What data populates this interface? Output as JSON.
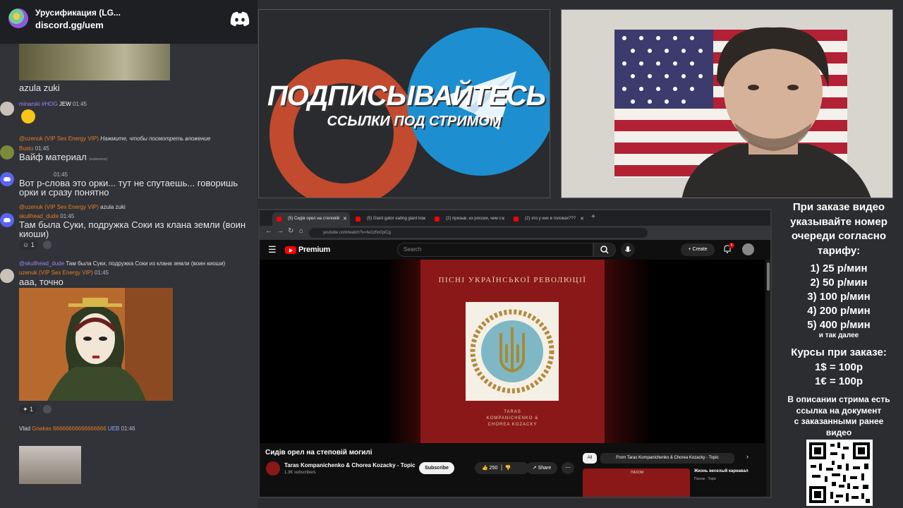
{
  "discord": {
    "server_name": "Урусификация (LG...",
    "invite_link": "discord.gg/uem",
    "messages": {
      "m1_text": "azula zuki",
      "m2_user": "minarski",
      "m2_tag": "#HOG",
      "m2_badge": "JEW",
      "m2_time": "01:45",
      "m3_reply_user": "@uzenuk (VIP Sex Energy VIP)",
      "m3_reply_text": "Нажмите, чтобы посмотреть вложение",
      "m3_user": "Bustu",
      "m3_time": "01:45",
      "m3_text": "Вайф материал",
      "m3_edited": "(изменено)",
      "m4_time": "01:45",
      "m4_text": "Вот р-слова это орки... тут не спутаешь... говоришь орки и сразу понятно",
      "m5_reply_user": "@uzenuk (VIP Sex Energy VIP)",
      "m5_reply_text": "azula zuki",
      "m5_user": "skullhead_dude",
      "m5_time": "01:45",
      "m5_text": "Там была Суки, подружка Соки из клана земли (воин киоши)",
      "m5_reaction_count": "1",
      "m6_reply_user": "@skullhead_dude",
      "m6_reply_text": "Там была Суки, подружка Соки из клана земли (воин киоши)",
      "m6_user": "uzenuk (VIP Sex Energy VIP)",
      "m6_time": "01:45",
      "m6_text": "ааа, точно",
      "m6_reaction_count": "1",
      "m7_user": "Vlad",
      "m7_name_tail": "Gnakas 66666666666666666",
      "m7_badge": "UEB",
      "m7_time": "01:46"
    }
  },
  "promo": {
    "headline": "ПОДПИСЫВАЙТЕСЬ",
    "subline": "ССЫЛКИ ПОД СТРИМОМ"
  },
  "browser": {
    "tabs": [
      {
        "label": "(5) Сидів орел на степовій"
      },
      {
        "label": "(5) Giant gator eating giant ko"
      },
      {
        "label": "(2) призыв, из россии, чем с"
      },
      {
        "label": "(2) это у них в головах???"
      }
    ],
    "url": "youtube.com/watch?v=tw1zfio0piCg",
    "youtube": {
      "brand": "Premium",
      "search_placeholder": "Search",
      "create_label": "Create",
      "notif_count": "9",
      "cover_title": "ПІСНІ УКРАЇНСЬКОЇ РЕВОЛЮЦІЇ",
      "cover_credit_1": "TARAS",
      "cover_credit_2": "KOMPANICHENKO &",
      "cover_credit_3": "CHOREA KOZACKY",
      "video_title": "Сидів орел на степовій могилі",
      "channel": "Taras Kompanichenko & Chorea Kozacky - Topic",
      "subscribers": "1.3K subscribers",
      "subscribe_label": "Subscribe",
      "likes": "250",
      "share_label": "Share",
      "chip_all": "All",
      "chip_from": "From Taras Kompanichenko & Chorea Kozacky - Topic",
      "related_title": "Жизнь веселый карнавал",
      "related_channel": "Пахом · Topic",
      "related_brand": "ПАХОМ"
    }
  },
  "pricing": {
    "heading_1": "При заказе видео",
    "heading_2": "указывайте номер",
    "heading_3": "очереди согласно",
    "heading_4": "тарифу:",
    "tiers": [
      "1) 25 р/мин",
      "2) 50 р/мин",
      "3) 100 р/мин",
      "4) 200 р/мин",
      "5) 400 р/мин"
    ],
    "etc": "и так далее",
    "rates_head": "Курсы при заказе:",
    "rate_usd": "1$ = 100р",
    "rate_eur": "1€ = 100р",
    "note_1": "В описании стрима есть",
    "note_2": "ссылка на документ",
    "note_3": "с заказанными ранее",
    "note_4": "видео"
  },
  "colors": {
    "discord_bg": "#313338",
    "accent_orange": "#e67e22",
    "yt_red": "#ff0000",
    "cover_red": "#8b1818",
    "promo_orange": "#c24a2e",
    "telegram_blue": "#1d8fd1"
  }
}
